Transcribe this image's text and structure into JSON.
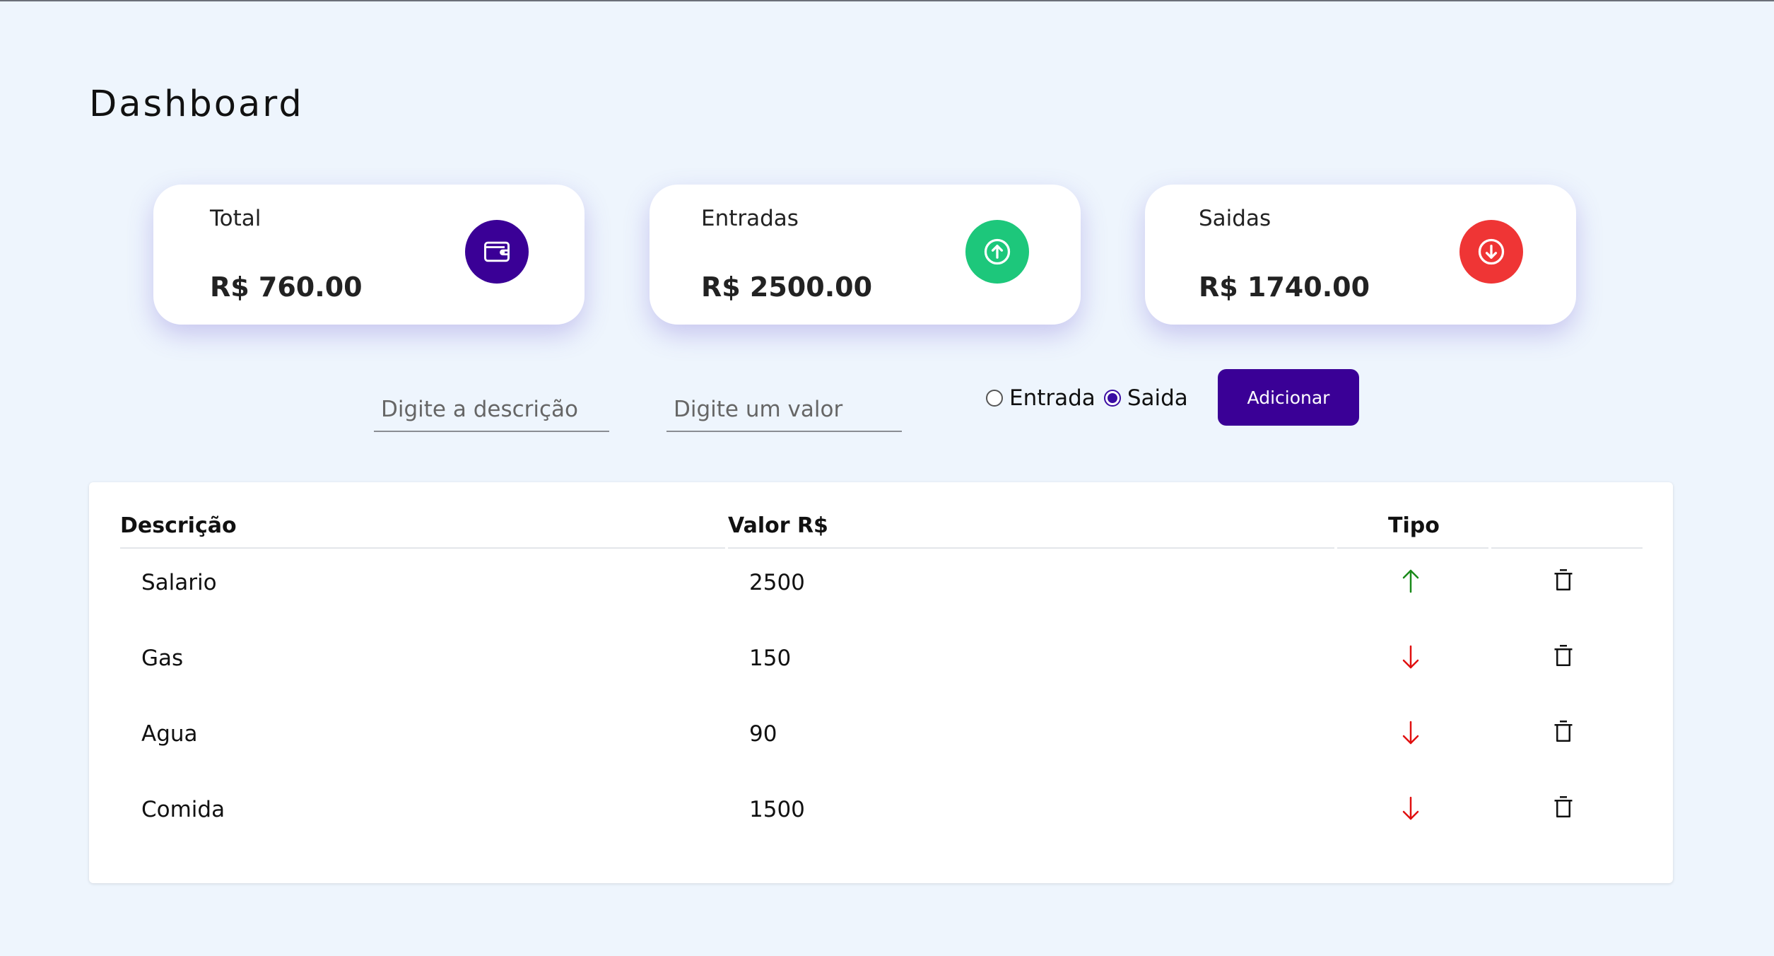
{
  "page_title": "Dashboard",
  "cards": {
    "total": {
      "label": "Total",
      "value": "R$ 760.00",
      "icon": "wallet-icon",
      "color": "#3a0096"
    },
    "entradas": {
      "label": "Entradas",
      "value": "R$ 2500.00",
      "icon": "arrow-up-circle-icon",
      "color": "#1dc77b"
    },
    "saidas": {
      "label": "Saidas",
      "value": "R$ 1740.00",
      "icon": "arrow-down-circle-icon",
      "color": "#ef3535"
    }
  },
  "form": {
    "desc_placeholder": "Digite a descrição",
    "desc_value": "",
    "valor_placeholder": "Digite um valor",
    "valor_value": "",
    "radio_entrada_label": "Entrada",
    "radio_saida_label": "Saida",
    "selected": "Saida",
    "add_button_label": "Adicionar"
  },
  "table": {
    "headers": {
      "descricao": "Descrição",
      "valor": "Valor R$",
      "tipo": "Tipo"
    },
    "rows": [
      {
        "descricao": "Salario",
        "valor": "2500",
        "tipo": "entrada"
      },
      {
        "descricao": "Gas",
        "valor": "150",
        "tipo": "saida"
      },
      {
        "descricao": "Agua",
        "valor": "90",
        "tipo": "saida"
      },
      {
        "descricao": "Comida",
        "valor": "1500",
        "tipo": "saida"
      }
    ]
  },
  "colors": {
    "accent": "#3a0096",
    "income": "#1a8a1a",
    "expense": "#e01010",
    "background": "#eef5fd"
  }
}
